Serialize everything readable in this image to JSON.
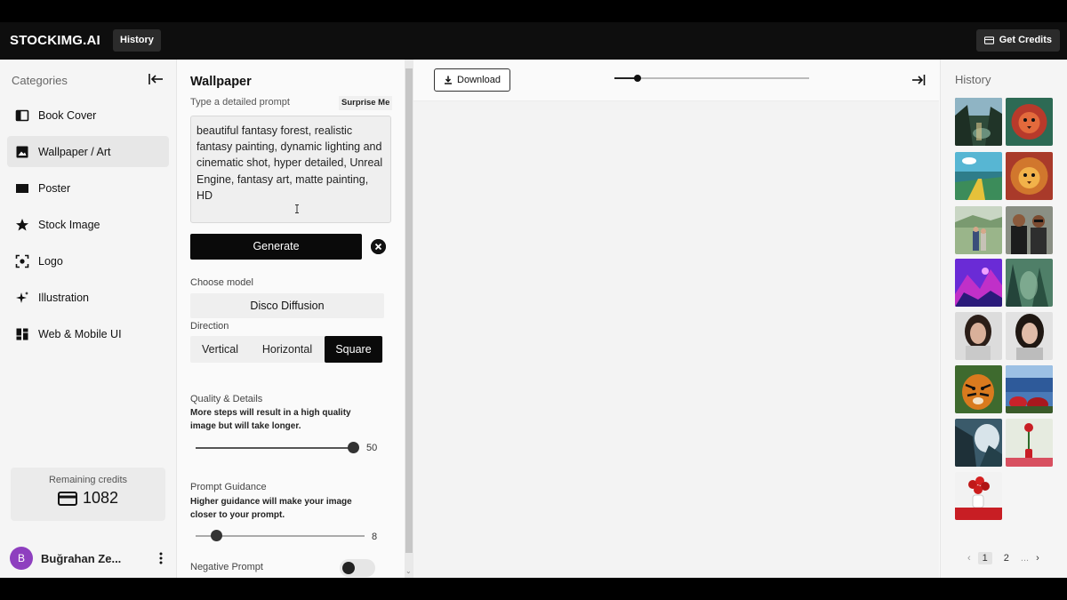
{
  "header": {
    "brand": "STOCKIMG.AI",
    "history_label": "History",
    "credits_label": "Get Credits"
  },
  "sidebar": {
    "title": "Categories",
    "items": [
      {
        "label": "Book Cover",
        "icon": "book-cover-icon",
        "active": false
      },
      {
        "label": "Wallpaper / Art",
        "icon": "image-icon",
        "active": true
      },
      {
        "label": "Poster",
        "icon": "poster-icon",
        "active": false
      },
      {
        "label": "Stock Image",
        "icon": "star-icon",
        "active": false
      },
      {
        "label": "Logo",
        "icon": "logo-focus-icon",
        "active": false
      },
      {
        "label": "Illustration",
        "icon": "sparkle-icon",
        "active": false
      },
      {
        "label": "Web & Mobile UI",
        "icon": "layout-grid-icon",
        "active": false
      }
    ],
    "remaining_label": "Remaining credits",
    "remaining_value": "1082",
    "user_initial": "B",
    "user_name": "Buğrahan Ze..."
  },
  "form": {
    "title": "Wallpaper",
    "prompt_label": "Type a detailed prompt",
    "surprise_label": "Surprise Me",
    "prompt_value": "beautiful fantasy forest, realistic fantasy painting, dynamic lighting and cinematic shot, hyper detailed, Unreal Engine, fantasy art, matte painting, HD",
    "generate_label": "Generate",
    "model_label": "Choose model",
    "model_value": "Disco Diffusion",
    "direction_label": "Direction",
    "directions": [
      "Vertical",
      "Horizontal",
      "Square"
    ],
    "direction_selected": "Square",
    "quality_label": "Quality & Details",
    "quality_desc": "More steps will result in a high quality image but will take longer.",
    "quality_value": "50",
    "quality_fraction": 0.98,
    "guidance_label": "Prompt Guidance",
    "guidance_desc": "Higher guidance will make your image closer to your prompt.",
    "guidance_value": "8",
    "guidance_fraction": 0.12,
    "negative_label": "Negative Prompt",
    "negative_enabled": false
  },
  "canvas": {
    "download_label": "Download",
    "zoom_fraction": 0.12
  },
  "history": {
    "title": "History",
    "pages": [
      "1",
      "2",
      "..."
    ],
    "current_page": "1",
    "thumbnails": [
      "forest-scene",
      "lion-logo",
      "landscape-road",
      "lion-logo-orange",
      "couple-field",
      "couple-portrait",
      "neon-mountains",
      "green-forest",
      "woman-portrait",
      "woman-portrait-2",
      "tiger",
      "sea-flowers",
      "forest-cliff",
      "red-flower-vase",
      "red-roses-vase"
    ]
  },
  "colors": {
    "accent": "#0a0a0a",
    "avatar": "#8e3fbf"
  }
}
